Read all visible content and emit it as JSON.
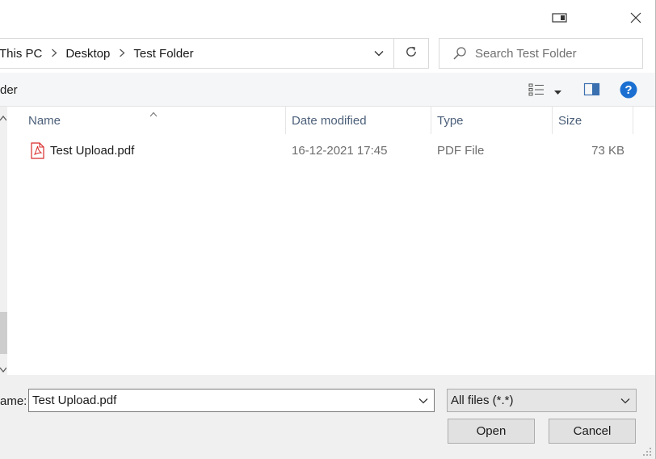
{
  "titlebar": {
    "snap_icon": "window-snap-icon",
    "close_icon": "close-icon"
  },
  "address": {
    "crumbs": [
      "This PC",
      "Desktop",
      "Test Folder"
    ],
    "dropdown_icon": "chevron-down-icon",
    "refresh_icon": "refresh-icon"
  },
  "search": {
    "placeholder": "Search Test Folder",
    "icon": "search-icon"
  },
  "commandbar": {
    "new_folder_label": "der",
    "view_icon": "view-options-icon",
    "preview_icon": "preview-pane-icon",
    "help_icon": "help-icon"
  },
  "columns": {
    "name": "Name",
    "date_modified": "Date modified",
    "type": "Type",
    "size": "Size"
  },
  "files": [
    {
      "name": "Test Upload.pdf",
      "date_modified": "16-12-2021 17:45",
      "type": "PDF File",
      "size": "73 KB",
      "icon": "pdf-file-icon"
    }
  ],
  "bottom": {
    "filename_label": "ame:",
    "filename_value": "Test Upload.pdf",
    "filter_value": "All files (*.*)",
    "open_label": "Open",
    "cancel_label": "Cancel"
  },
  "colors": {
    "header_text": "#4c607a",
    "help_blue": "#1a6fd1",
    "pdf_red": "#d92b2b"
  }
}
